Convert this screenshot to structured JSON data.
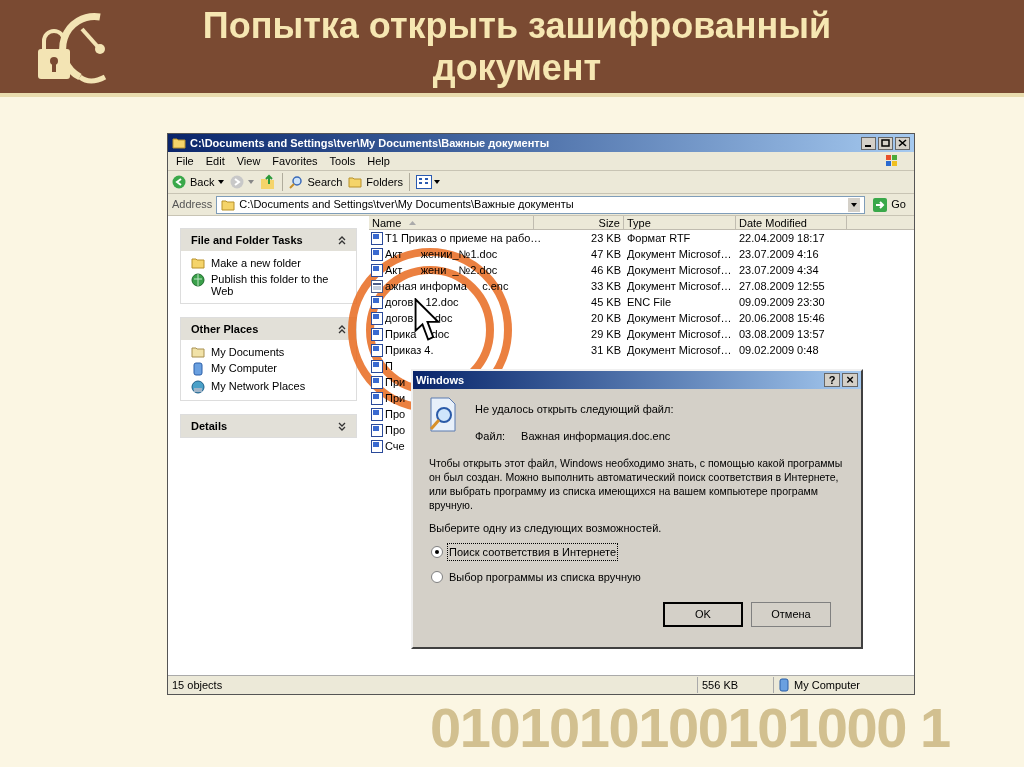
{
  "slide": {
    "title": "Попытка открыть зашифрованный документ",
    "decoration_digits": "0101010100101000 1"
  },
  "explorer": {
    "title": "C:\\Documents and Settings\\tver\\My Documents\\Важные документы",
    "menu": [
      "File",
      "Edit",
      "View",
      "Favorites",
      "Tools",
      "Help"
    ],
    "toolbar": {
      "back": "Back",
      "search": "Search",
      "folders": "Folders"
    },
    "address": {
      "label": "Address",
      "value": "C:\\Documents and Settings\\tver\\My Documents\\Важные документы",
      "go": "Go"
    },
    "panels": [
      {
        "title": "File and Folder Tasks",
        "expanded": true,
        "items": [
          {
            "label": "Make a new folder"
          },
          {
            "label": "Publish this folder to the Web"
          }
        ]
      },
      {
        "title": "Other Places",
        "expanded": true,
        "items": [
          {
            "label": "My Documents"
          },
          {
            "label": "My Computer"
          },
          {
            "label": "My Network Places"
          }
        ]
      },
      {
        "title": "Details",
        "expanded": false
      }
    ],
    "columns": [
      "Name",
      "Size",
      "Type",
      "Date Modified"
    ],
    "rows": [
      {
        "name": "Т1 Приказ о приеме на рабо…",
        "size": "23 KB",
        "type": "Формат RTF",
        "date": "22.04.2009 18:17",
        "kind": "doc"
      },
      {
        "name": "Акт      жении_№1.doc",
        "size": "47 KB",
        "type": "Документ Microsof…",
        "date": "23.07.2009 4:16",
        "kind": "doc"
      },
      {
        "name": "Акт      жени  _№2.doc",
        "size": "46 KB",
        "type": "Документ Microsof…",
        "date": "23.07.2009 4:34",
        "kind": "doc"
      },
      {
        "name": "ажная информа     c.enc",
        "size": "33 KB",
        "type": "Документ Microsof…",
        "date": "27.08.2009 12:55",
        "kind": "enc"
      },
      {
        "name": "догов    12.doc",
        "size": "45 KB",
        "type": "ENC File",
        "date": "09.09.2009 23:30",
        "kind": "doc"
      },
      {
        "name": "догов       doc",
        "size": "20 KB",
        "type": "Документ Microsof…",
        "date": "20.06.2008 15:46",
        "kind": "doc"
      },
      {
        "name": "Прика     doc",
        "size": "29 KB",
        "type": "Документ Microsof…",
        "date": "03.08.2009 13:57",
        "kind": "doc"
      },
      {
        "name": "Приказ 4.",
        "size": "31 KB",
        "type": "Документ Microsof…",
        "date": "09.02.2009 0:48",
        "kind": "doc"
      },
      {
        "name": "П",
        "kind": "doc"
      },
      {
        "name": "При",
        "kind": "doc"
      },
      {
        "name": "При",
        "kind": "doc"
      },
      {
        "name": "Про",
        "kind": "doc"
      },
      {
        "name": "Про",
        "kind": "doc"
      },
      {
        "name": "Сче",
        "kind": "doc"
      }
    ],
    "status": {
      "objects": "15 objects",
      "size": "556 KB",
      "zone": "My Computer"
    }
  },
  "dialog": {
    "title": "Windows",
    "help": "?",
    "close": "×",
    "heading": "Не удалось открыть следующий файл:",
    "file_label": "Файл:",
    "file_name": "Важная информация.doc.enc",
    "message": "Чтобы открыть этот файл, Windows необходимо знать, с помощью какой программы он был создан. Можно выполнить автоматический поиск соответствия в Интернете, или выбрать программу из списка имеющихся на вашем компьютере программ вручную.",
    "prompt": "Выберите одну из следующих возможностей.",
    "options": [
      {
        "label": "Поиск соответствия в Интернете",
        "selected": true
      },
      {
        "label": "Выбор программы из списка вручную",
        "selected": false
      }
    ],
    "buttons": [
      "OK",
      "Отмена"
    ]
  }
}
